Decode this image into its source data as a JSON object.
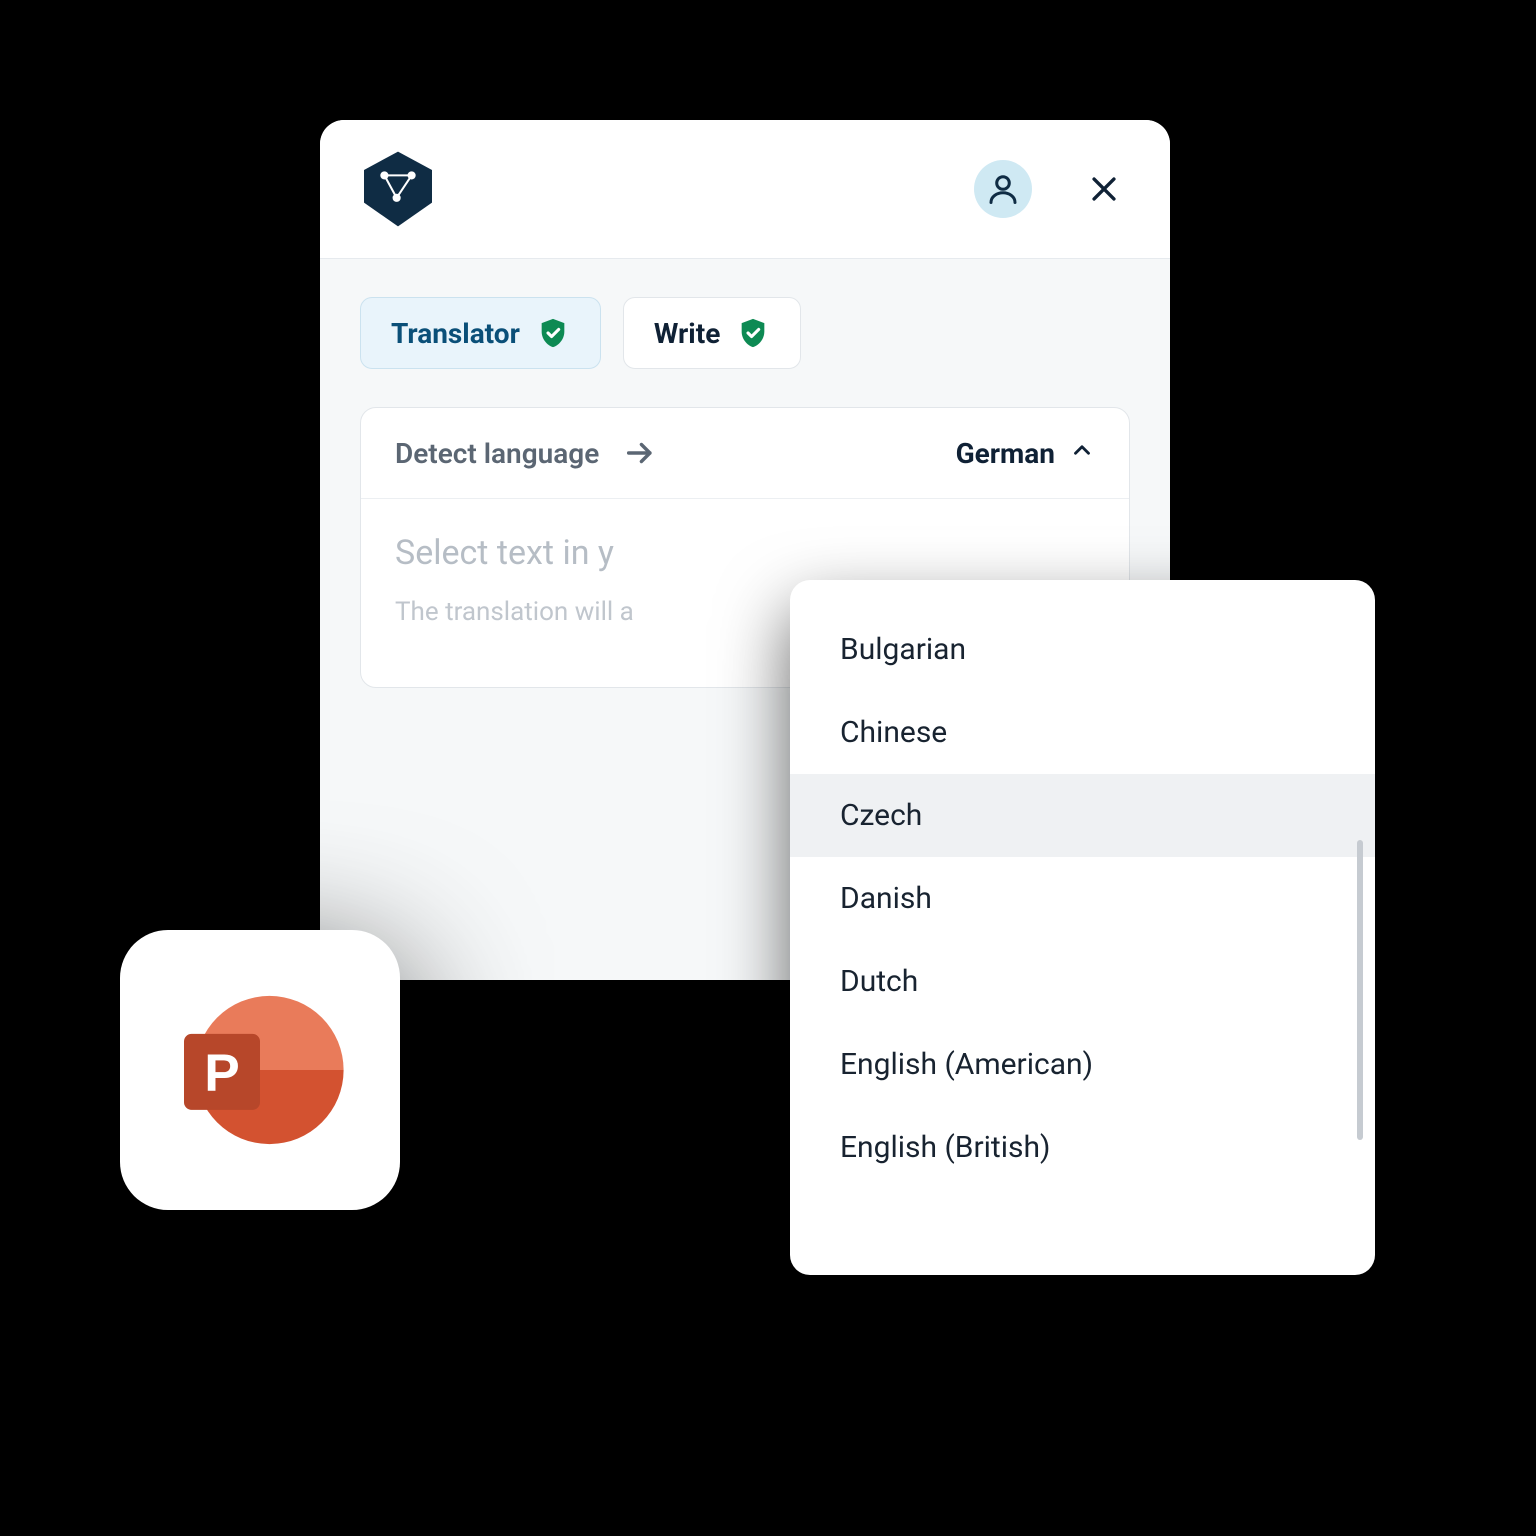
{
  "header": {
    "avatar_icon": "person-icon",
    "close_icon": "close-icon",
    "brand_icon": "deepl-logo"
  },
  "tabs": {
    "translator": {
      "label": "Translator",
      "active": true
    },
    "write": {
      "label": "Write",
      "active": false
    }
  },
  "language": {
    "source_label": "Detect language",
    "arrow_icon": "arrow-right-icon",
    "target_label": "German",
    "target_chevron": "chevron-up-icon"
  },
  "textarea": {
    "placeholder_main": "Select text in y",
    "placeholder_sub": "The translation will a"
  },
  "dropdown": {
    "items": [
      "Bulgarian",
      "Chinese",
      "Czech",
      "Danish",
      "Dutch",
      "English (American)",
      "English (British)"
    ],
    "highlight_index": 2
  },
  "ppt": {
    "letter": "P",
    "icon": "powerpoint-icon"
  },
  "colors": {
    "brand_dark": "#0f2c44",
    "avatar_bg": "#cfe9f3",
    "shield_green": "#0d8a53",
    "tab_active_bg": "#e9f4fb",
    "tab_active_text": "#0a4f78",
    "ppt_orange": "#d35230",
    "ppt_orange_light": "#e97b5a",
    "ppt_red": "#b7472a"
  }
}
